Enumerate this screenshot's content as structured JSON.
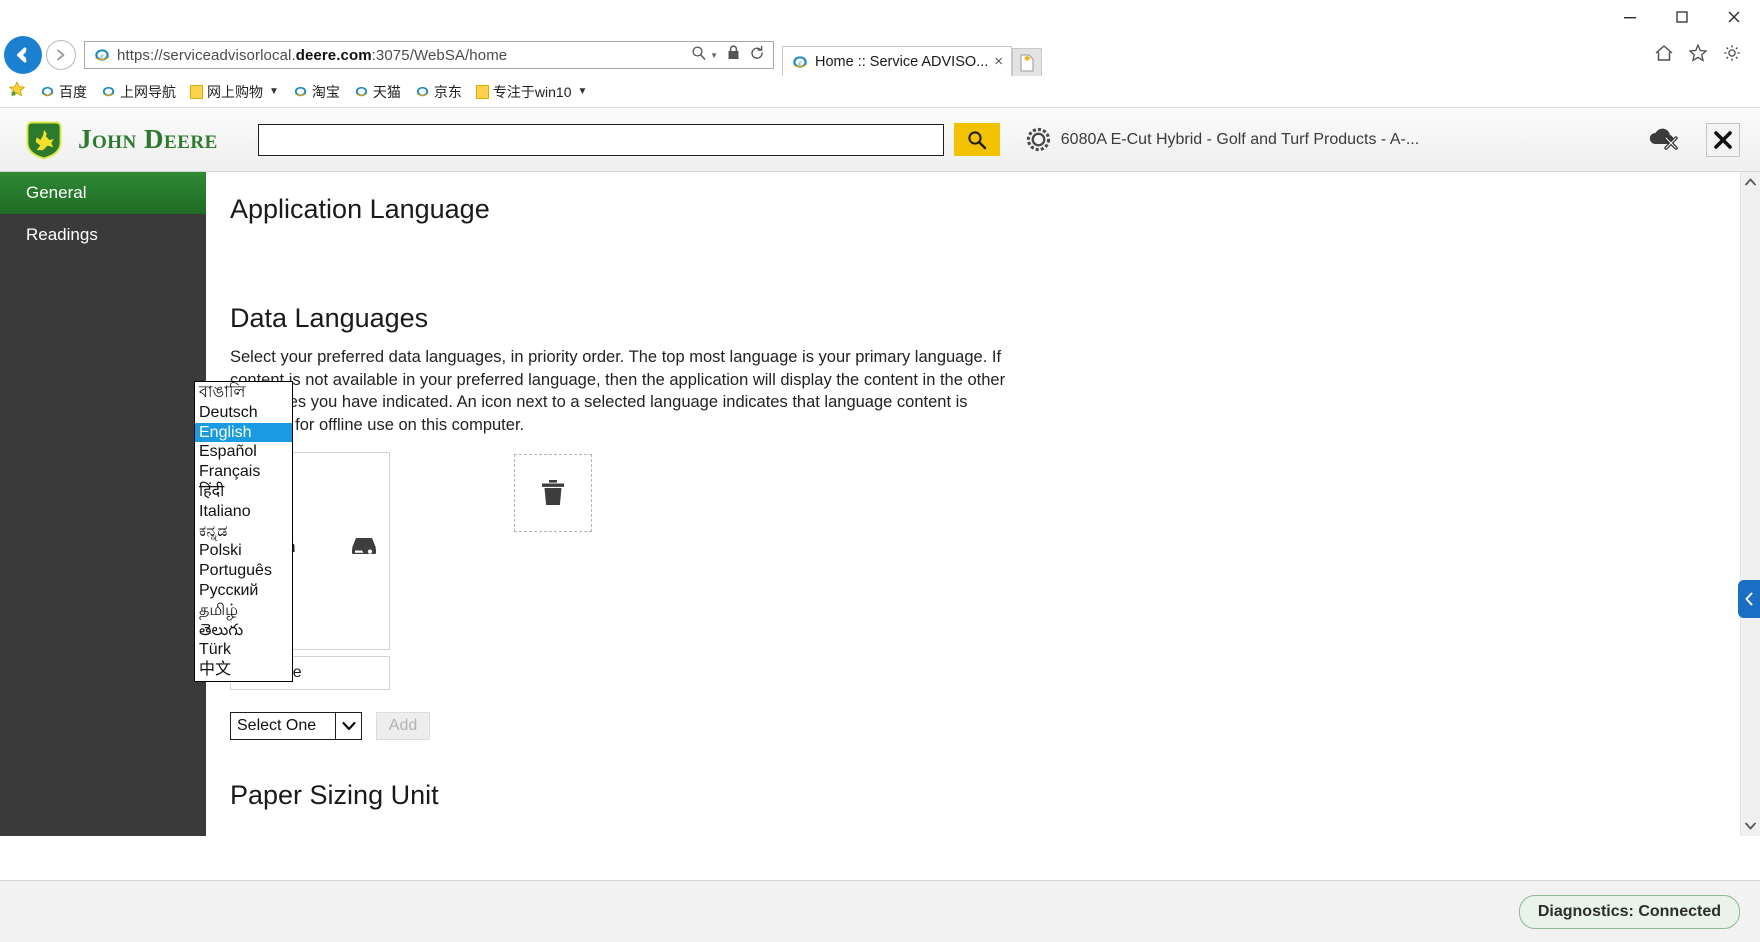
{
  "window": {
    "minimize_label": "minimize-icon",
    "maximize_label": "maximize-icon",
    "close_label": "close-icon"
  },
  "browser": {
    "url": "https://serviceadvisorlocal.deere.com:3075/WebSA/home",
    "url_bold": "deere.com",
    "url_pre": "https://serviceadvisorlocal.",
    "url_post": ":3075/WebSA/home",
    "back_icon": "back-arrow-icon",
    "forward_icon": "forward-arrow-icon",
    "search_icon": "search-icon",
    "lock_icon": "lock-icon",
    "refresh_icon": "refresh-icon",
    "tab_title": "Home :: Service ADVISO...",
    "tab_close": "×",
    "new_tab_label": "new-tab-icon",
    "home_icon": "home-icon",
    "favorites_icon": "star-icon",
    "tools_icon": "gear-icon",
    "favorites": [
      {
        "label": "百度",
        "icon": "ie-icon",
        "dropdown": false
      },
      {
        "label": "上网导航",
        "icon": "ie-icon",
        "dropdown": false
      },
      {
        "label": "网上购物",
        "icon": "folder-icon",
        "dropdown": true
      },
      {
        "label": "淘宝",
        "icon": "ie-icon",
        "dropdown": false
      },
      {
        "label": "天猫",
        "icon": "ie-icon",
        "dropdown": false
      },
      {
        "label": "京东",
        "icon": "ie-icon",
        "dropdown": false
      },
      {
        "label": "专注于win10",
        "icon": "folder-icon",
        "dropdown": true
      }
    ]
  },
  "app_header": {
    "brand": "John Deere",
    "search_value": "",
    "search_placeholder": "",
    "go_icon": "search-icon",
    "machine_icon": "gear-icon",
    "machine": "6080A E-Cut Hybrid - Golf and Turf Products - A-...",
    "offline_icon": "cloud-offline-icon",
    "close_icon": "close-x-icon"
  },
  "sidebar": {
    "items": [
      {
        "label": "General",
        "active": true
      },
      {
        "label": "Readings",
        "active": false
      }
    ]
  },
  "main": {
    "application_language_heading": "Application Language",
    "data_languages_heading": "Data Languages",
    "description": "Select your preferred data languages, in priority order. The top most language is your primary language. If content is not available in your preferred language, then the application will display the content in the other languages you have indicated. An icon next to a selected language indicates that language content is installed for offline use on this computer.",
    "selected_languages": [
      {
        "label": "English",
        "installed": true,
        "icon": "hard-drive-icon"
      }
    ],
    "pending_language": "Chinese",
    "trash_icon": "trash-icon",
    "select_one_value": "Select One",
    "select_caret": "chevron-down-icon",
    "add_button": "Add",
    "paper_sizing_heading": "Paper Sizing Unit"
  },
  "language_dropdown": {
    "selected": "English",
    "options": [
      "বাঙালি",
      "Deutsch",
      "English",
      "Español",
      "Français",
      "हिंदी",
      "Italiano",
      "ಕನ್ನಡ",
      "Polski",
      "Português",
      "Русский",
      "தமிழ்",
      "తెలుగు",
      "Türk",
      "中文"
    ]
  },
  "panel_toggle": {
    "icon": "chevron-left-icon"
  },
  "scrollbar": {
    "up_icon": "chevron-up-icon",
    "down_icon": "chevron-down-icon"
  },
  "status": {
    "diagnostics": "Diagnostics: Connected"
  },
  "colors": {
    "brand_green": "#2d7a2f",
    "sidebar_active": "#2f8a34",
    "accent_yellow": "#f2c200",
    "dropdown_select": "#1a9ae1",
    "status_green_border": "#8fb98f"
  }
}
